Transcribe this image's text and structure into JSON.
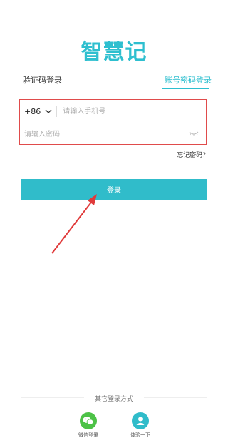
{
  "app": {
    "logo_text": "智慧记"
  },
  "tabs": [
    {
      "label": "验证码登录"
    },
    {
      "label": "账号密码登录"
    }
  ],
  "form": {
    "country_code": "+86",
    "phone_placeholder": "请输入手机号",
    "password_placeholder": "请输入密码",
    "forgot_label": "忘记密码?"
  },
  "login_button": {
    "label": "登录"
  },
  "other_login": {
    "title": "其它登录方式",
    "options": [
      {
        "label": "微信登录",
        "icon": "wechat-icon"
      },
      {
        "label": "体验一下",
        "icon": "user-icon"
      }
    ]
  },
  "colors": {
    "accent": "#30bcca",
    "highlight_border": "#e04b4b",
    "wechat": "#4dc247",
    "annotation_arrow": "#e03a3a"
  }
}
